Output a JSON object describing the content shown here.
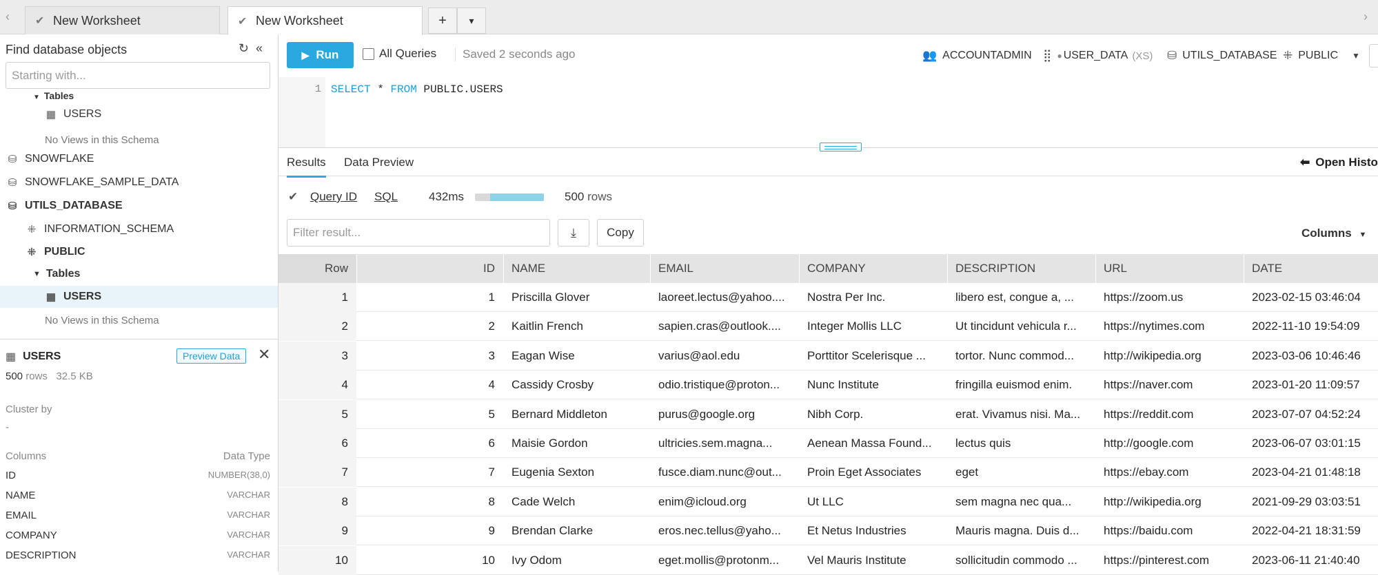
{
  "tabs": [
    {
      "label": "New Worksheet"
    },
    {
      "label": "New Worksheet"
    }
  ],
  "tab_add": "+",
  "tab_menu": "▾",
  "sidebar": {
    "find_label": "Find database objects",
    "find_placeholder": "Starting with...",
    "tree": [
      {
        "label": "Tables"
      },
      {
        "label": "USERS"
      },
      {
        "label": "No Views in this Schema"
      },
      {
        "label": "SNOWFLAKE"
      },
      {
        "label": "SNOWFLAKE_SAMPLE_DATA"
      },
      {
        "label": "UTILS_DATABASE"
      },
      {
        "label": "INFORMATION_SCHEMA"
      },
      {
        "label": "PUBLIC"
      },
      {
        "label": "Tables"
      },
      {
        "label": "USERS"
      },
      {
        "label": "No Views in this Schema"
      }
    ]
  },
  "table_info": {
    "name": "USERS",
    "preview_label": "Preview Data",
    "rows_count": "500",
    "rows_label": "rows",
    "size": "32.5 KB",
    "cluster_label": "Cluster by",
    "cluster_value": "-",
    "columns_label": "Columns",
    "datatype_label": "Data Type",
    "columns": [
      {
        "name": "ID",
        "type": "NUMBER(38,0)"
      },
      {
        "name": "NAME",
        "type": "VARCHAR"
      },
      {
        "name": "EMAIL",
        "type": "VARCHAR"
      },
      {
        "name": "COMPANY",
        "type": "VARCHAR"
      },
      {
        "name": "DESCRIPTION",
        "type": "VARCHAR"
      }
    ]
  },
  "toolbar": {
    "run_label": "Run",
    "all_queries_label": "All Queries",
    "saved_text": "Saved 2 seconds ago",
    "role": "ACCOUNTADMIN",
    "warehouse": "USER_DATA",
    "warehouse_size": "(XS)",
    "database": "UTILS_DATABASE",
    "schema": "PUBLIC"
  },
  "editor": {
    "line_number": "1",
    "kw_select": "SELECT",
    "star": " * ",
    "kw_from": "FROM",
    "target": " PUBLIC.USERS"
  },
  "results": {
    "tab_results": "Results",
    "tab_preview": "Data Preview",
    "open_history": "Open History",
    "query_id_label": "Query ID",
    "sql_label": "SQL",
    "duration": "432ms",
    "progress_fraction": 0.78,
    "rows_count": "500",
    "rows_label": "rows",
    "filter_placeholder": "Filter result...",
    "copy_label": "Copy",
    "columns_label": "Columns",
    "headers": [
      "Row",
      "ID",
      "NAME",
      "EMAIL",
      "COMPANY",
      "DESCRIPTION",
      "URL",
      "DATE"
    ],
    "rows": [
      [
        "1",
        "1",
        "Priscilla Glover",
        "laoreet.lectus@yahoo....",
        "Nostra Per Inc.",
        "libero est, congue a, ...",
        "https://zoom.us",
        "2023-02-15 03:46:04"
      ],
      [
        "2",
        "2",
        "Kaitlin French",
        "sapien.cras@outlook....",
        "Integer Mollis LLC",
        "Ut tincidunt vehicula r...",
        "https://nytimes.com",
        "2022-11-10 19:54:09"
      ],
      [
        "3",
        "3",
        "Eagan Wise",
        "varius@aol.edu",
        "Porttitor Scelerisque ...",
        "tortor. Nunc commod...",
        "http://wikipedia.org",
        "2023-03-06 10:46:46"
      ],
      [
        "4",
        "4",
        "Cassidy Crosby",
        "odio.tristique@proton...",
        "Nunc Institute",
        "fringilla euismod enim.",
        "https://naver.com",
        "2023-01-20 11:09:57"
      ],
      [
        "5",
        "5",
        "Bernard Middleton",
        "purus@google.org",
        "Nibh Corp.",
        "erat. Vivamus nisi. Ma...",
        "https://reddit.com",
        "2023-07-07 04:52:24"
      ],
      [
        "6",
        "6",
        "Maisie Gordon",
        "ultricies.sem.magna...",
        "Aenean Massa Found...",
        "lectus quis",
        "http://google.com",
        "2023-06-07 03:01:15"
      ],
      [
        "7",
        "7",
        "Eugenia Sexton",
        "fusce.diam.nunc@out...",
        "Proin Eget Associates",
        "eget",
        "https://ebay.com",
        "2023-04-21 01:48:18"
      ],
      [
        "8",
        "8",
        "Cade Welch",
        "enim@icloud.org",
        "Ut LLC",
        "sem magna nec qua...",
        "http://wikipedia.org",
        "2021-09-29 03:03:51"
      ],
      [
        "9",
        "9",
        "Brendan Clarke",
        "eros.nec.tellus@yaho...",
        "Et Netus Industries",
        "Mauris magna. Duis d...",
        "https://baidu.com",
        "2022-04-21 18:31:59"
      ],
      [
        "10",
        "10",
        "Ivy Odom",
        "eget.mollis@protonm...",
        "Vel Mauris Institute",
        "sollicitudin commodo ...",
        "https://pinterest.com",
        "2023-06-11 21:40:40"
      ]
    ]
  },
  "colors": {
    "accent": "#29a9e0",
    "keyword": "#1aa0d8",
    "header_bg": "#e4e4e4",
    "selection_bg": "#e9f4fa"
  }
}
